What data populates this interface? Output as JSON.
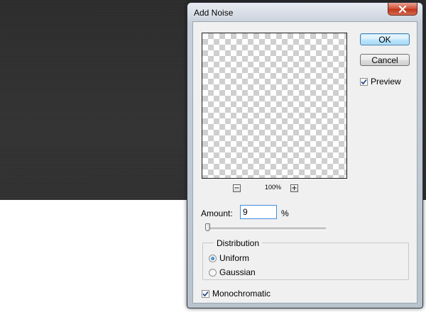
{
  "dialog": {
    "title": "Add Noise",
    "ok_label": "OK",
    "cancel_label": "Cancel",
    "preview_label": "Preview",
    "preview_checked": true,
    "zoom_out_label": "−",
    "zoom_in_label": "+",
    "zoom_level": "100%",
    "amount_label": "Amount:",
    "amount_value": "9",
    "amount_unit": "%",
    "distribution": {
      "title": "Distribution",
      "options": [
        "Uniform",
        "Gaussian"
      ],
      "selected": "Uniform"
    },
    "monochromatic_label": "Monochromatic",
    "monochromatic_checked": true
  },
  "icons": {
    "close": "close-icon",
    "check": "checkmark-icon"
  },
  "colors": {
    "default_button": "#3c7fb1",
    "close_button": "#c0371d",
    "radio_selected": "#0f5a9a"
  }
}
